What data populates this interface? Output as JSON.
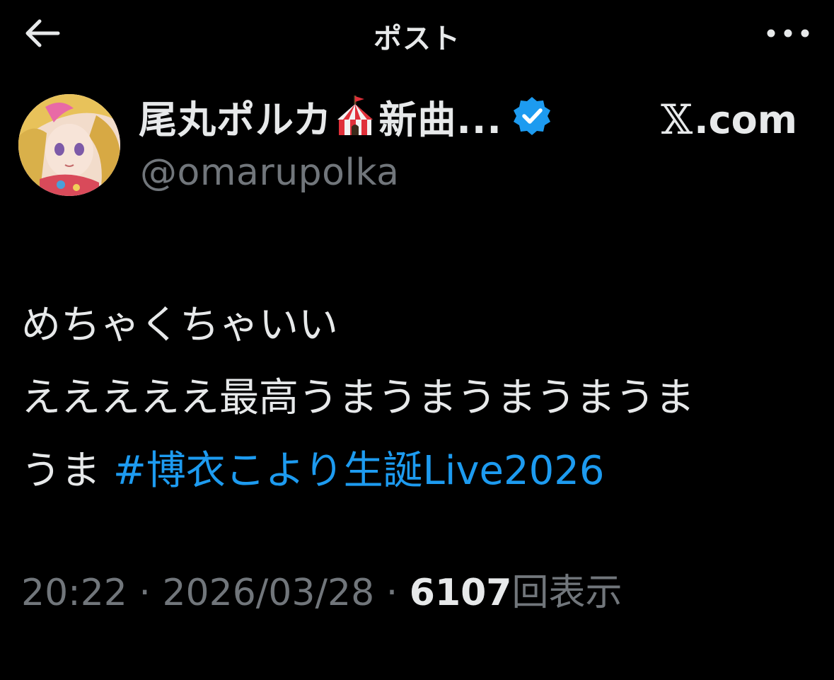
{
  "topbar": {
    "title": "ポスト",
    "back_icon": "arrow-left-icon",
    "more_icon": "ellipsis-icon"
  },
  "author": {
    "display_name_prefix": "尾丸ポルカ",
    "display_name_emoji": "circus-tent-icon",
    "display_name_suffix": "新曲...",
    "verified": true,
    "username": "@omarupolka",
    "domain_mark": "𝕏",
    "domain_text": ".com"
  },
  "post": {
    "line1": "めちゃくちゃいい",
    "line2": "えええええ最高うまうまうまうまうま",
    "line3_text": "うま ",
    "hashtag": "#博衣こより生誕Live2026"
  },
  "meta": {
    "time": "20:22",
    "sep1": " · ",
    "date": "2026/03/28",
    "sep2": " · ",
    "views_count": "6107",
    "views_label": "回表示"
  },
  "colors": {
    "background": "#000000",
    "text": "#e7e9ea",
    "muted": "#71767b",
    "link": "#1d9bf0",
    "verified": "#1d9bf0"
  }
}
